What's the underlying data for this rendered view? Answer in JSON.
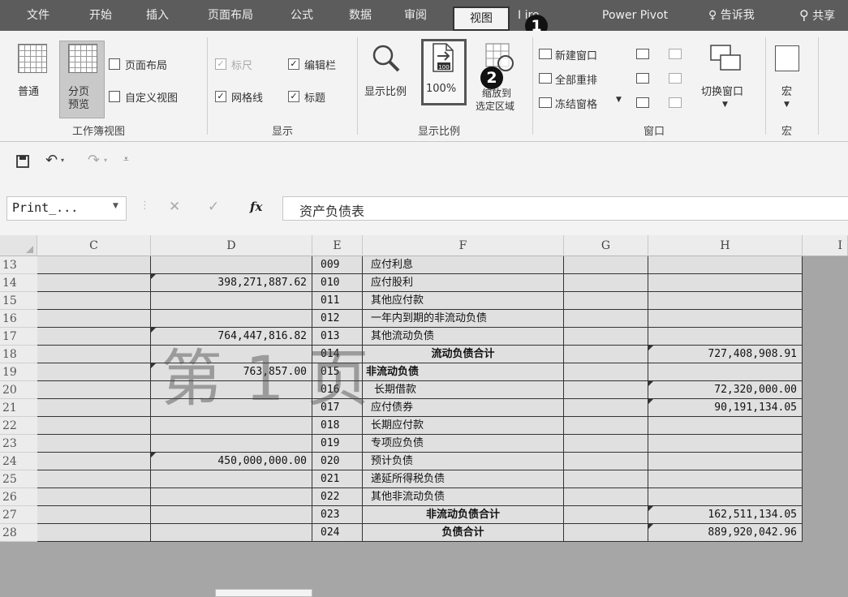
{
  "tabs": {
    "file": "文件",
    "home": "开始",
    "insert": "插入",
    "page_layout": "页面布局",
    "formulas": "公式",
    "data": "数据",
    "review": "审阅",
    "view": "视图",
    "inquire": "I ire",
    "power_pivot": "Power Pivot",
    "tell_me": "告诉我",
    "share": "共享"
  },
  "badges": {
    "step1": "1",
    "step2": "2"
  },
  "ribbon": {
    "workbook_views": {
      "normal": "普通",
      "page_break_line1": "分页",
      "page_break_line2": "预览",
      "page_layout": "页面布局",
      "custom_views": "自定义视图",
      "group_title": "工作簿视图"
    },
    "show": {
      "ruler": "标尺",
      "formula_bar": "编辑栏",
      "gridlines": "网格线",
      "headings": "标题",
      "check": "✓",
      "group_title": "显示"
    },
    "zoom": {
      "zoom": "显示比例",
      "hundred": "100%",
      "hundred_icon": "100",
      "to_selection_line1": "缩放到",
      "to_selection_line2": "选定区域",
      "group_title": "显示比例"
    },
    "window": {
      "new_window": "新建窗口",
      "arrange_all": "全部重排",
      "freeze_panes": "冻结窗格",
      "switch_windows": "切换窗口",
      "group_title": "窗口"
    },
    "macros": {
      "macros": "宏",
      "group_title": "宏"
    }
  },
  "formula_bar": {
    "name_box": "Print_...",
    "fx": "fx",
    "content": "资产负债表"
  },
  "columns": [
    "C",
    "D",
    "E",
    "F",
    "G",
    "H",
    "I"
  ],
  "watermark": "第 1 页",
  "rows": [
    {
      "num": "13",
      "d": "",
      "e": "009",
      "f": "应付利息",
      "h": "",
      "style": "",
      "dmark": false,
      "hmark": false
    },
    {
      "num": "14",
      "d": "398,271,887.62",
      "e": "010",
      "f": "应付股利",
      "h": "",
      "style": "",
      "dmark": true,
      "hmark": false
    },
    {
      "num": "15",
      "d": "",
      "e": "011",
      "f": "其他应付款",
      "h": "",
      "style": "",
      "dmark": false,
      "hmark": false
    },
    {
      "num": "16",
      "d": "",
      "e": "012",
      "f": "一年内到期的非流动负债",
      "h": "",
      "style": "",
      "dmark": false,
      "hmark": false
    },
    {
      "num": "17",
      "d": "764,447,816.82",
      "e": "013",
      "f": "其他流动负债",
      "h": "",
      "style": "",
      "dmark": true,
      "hmark": false
    },
    {
      "num": "18",
      "d": "",
      "e": "014",
      "f": "流动负债合计",
      "h": "727,408,908.91",
      "style": "bold center",
      "dmark": false,
      "hmark": true
    },
    {
      "num": "19",
      "d": "763,857.00",
      "e": "015",
      "f": "非流动负债",
      "h": "",
      "style": "bold hang",
      "dmark": true,
      "hmark": false
    },
    {
      "num": "20",
      "d": "",
      "e": "016",
      "f": "长期借款",
      "h": "72,320,000.00",
      "style": "indent",
      "dmark": false,
      "hmark": true
    },
    {
      "num": "21",
      "d": "",
      "e": "017",
      "f": "应付债券",
      "h": "90,191,134.05",
      "style": "",
      "dmark": false,
      "hmark": true
    },
    {
      "num": "22",
      "d": "",
      "e": "018",
      "f": "长期应付款",
      "h": "",
      "style": "",
      "dmark": false,
      "hmark": false
    },
    {
      "num": "23",
      "d": "",
      "e": "019",
      "f": "专项应负债",
      "h": "",
      "style": "",
      "dmark": false,
      "hmark": false
    },
    {
      "num": "24",
      "d": "450,000,000.00",
      "e": "020",
      "f": "预计负债",
      "h": "",
      "style": "",
      "dmark": true,
      "hmark": false
    },
    {
      "num": "25",
      "d": "",
      "e": "021",
      "f": "递延所得税负债",
      "h": "",
      "style": "",
      "dmark": false,
      "hmark": false
    },
    {
      "num": "26",
      "d": "",
      "e": "022",
      "f": "其他非流动负债",
      "h": "",
      "style": "",
      "dmark": false,
      "hmark": false
    },
    {
      "num": "27",
      "d": "",
      "e": "023",
      "f": "非流动负债合计",
      "h": "162,511,134.05",
      "style": "bold center",
      "dmark": false,
      "hmark": true
    },
    {
      "num": "28",
      "d": "",
      "e": "024",
      "f": "负债合计",
      "h": "889,920,042.96",
      "style": "bold center",
      "dmark": false,
      "hmark": true
    }
  ]
}
